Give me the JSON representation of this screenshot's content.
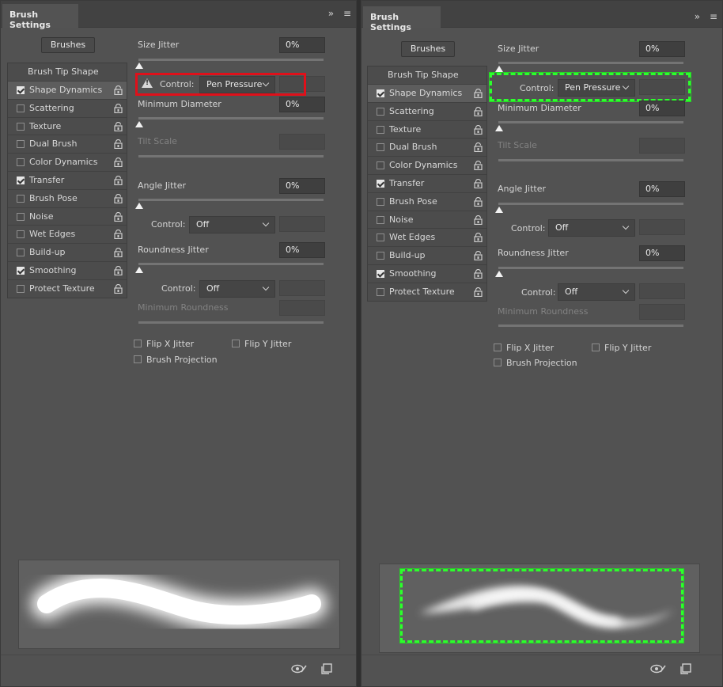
{
  "left": {
    "tab_title": "Brush Settings",
    "brushes_button": "Brushes",
    "tip_shape": "Brush Tip Shape",
    "items": [
      {
        "label": "Shape Dynamics",
        "checked": true,
        "selected": true
      },
      {
        "label": "Scattering",
        "checked": false
      },
      {
        "label": "Texture",
        "checked": false
      },
      {
        "label": "Dual Brush",
        "checked": false
      },
      {
        "label": "Color Dynamics",
        "checked": false
      },
      {
        "label": "Transfer",
        "checked": true
      },
      {
        "label": "Brush Pose",
        "checked": false
      },
      {
        "label": "Noise",
        "checked": false
      },
      {
        "label": "Wet Edges",
        "checked": false
      },
      {
        "label": "Build-up",
        "checked": false
      },
      {
        "label": "Smoothing",
        "checked": true
      },
      {
        "label": "Protect Texture",
        "checked": false
      }
    ],
    "size_jitter": "Size Jitter",
    "size_jitter_value": "0%",
    "control_label": "Control:",
    "control_value": "Pen Pressure",
    "min_diameter": "Minimum Diameter",
    "min_diameter_value": "0%",
    "tilt_scale": "Tilt Scale",
    "angle_jitter": "Angle Jitter",
    "angle_jitter_value": "0%",
    "angle_control_label": "Control:",
    "angle_control_value": "Off",
    "roundness_jitter": "Roundness Jitter",
    "roundness_jitter_value": "0%",
    "round_control_label": "Control:",
    "round_control_value": "Off",
    "min_roundness": "Minimum Roundness",
    "flip_x": "Flip X Jitter",
    "flip_y": "Flip Y Jitter",
    "brush_projection": "Brush Projection",
    "highlight_color": "#e0101a"
  },
  "right": {
    "tab_title": "Brush Settings",
    "brushes_button": "Brushes",
    "tip_shape": "Brush Tip Shape",
    "items": [
      {
        "label": "Shape Dynamics",
        "checked": true,
        "selected": true
      },
      {
        "label": "Scattering",
        "checked": false
      },
      {
        "label": "Texture",
        "checked": false
      },
      {
        "label": "Dual Brush",
        "checked": false
      },
      {
        "label": "Color Dynamics",
        "checked": false
      },
      {
        "label": "Transfer",
        "checked": true
      },
      {
        "label": "Brush Pose",
        "checked": false
      },
      {
        "label": "Noise",
        "checked": false
      },
      {
        "label": "Wet Edges",
        "checked": false
      },
      {
        "label": "Build-up",
        "checked": false
      },
      {
        "label": "Smoothing",
        "checked": true
      },
      {
        "label": "Protect Texture",
        "checked": false
      }
    ],
    "size_jitter": "Size Jitter",
    "size_jitter_value": "0%",
    "control_label": "Control:",
    "control_value": "Pen Pressure",
    "min_diameter": "Minimum Diameter",
    "min_diameter_value": "0%",
    "tilt_scale": "Tilt Scale",
    "angle_jitter": "Angle Jitter",
    "angle_jitter_value": "0%",
    "angle_control_label": "Control:",
    "angle_control_value": "Off",
    "roundness_jitter": "Roundness Jitter",
    "roundness_jitter_value": "0%",
    "round_control_label": "Control:",
    "round_control_value": "Off",
    "min_roundness": "Minimum Roundness",
    "flip_x": "Flip X Jitter",
    "flip_y": "Flip Y Jitter",
    "brush_projection": "Brush Projection",
    "highlight_color": "#2cff2c"
  },
  "icons": {
    "expand": "double-chevron-right-icon",
    "menu": "hamburger-menu-icon",
    "lock": "lock-icon",
    "warning": "warning-icon",
    "eye": "toggle-preview-icon",
    "new": "create-new-brush-icon"
  }
}
